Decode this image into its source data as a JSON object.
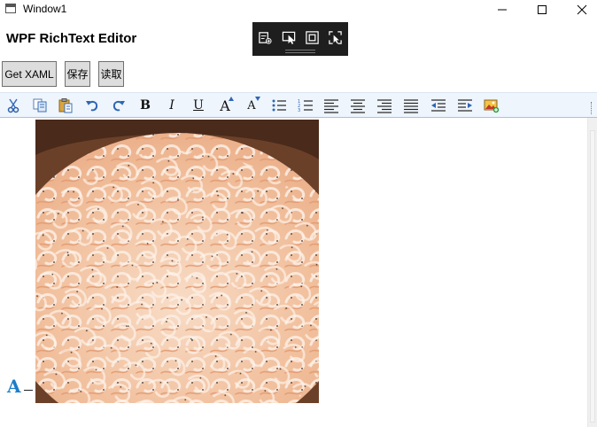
{
  "window": {
    "title": "Window1"
  },
  "app": {
    "heading": "WPF RichText Editor"
  },
  "buttons": {
    "get_xaml": "Get XAML",
    "save": "保存",
    "read": "读取"
  },
  "toolbar_icons": [
    "cut-icon",
    "copy-icon",
    "paste-icon",
    "undo-icon",
    "redo-icon",
    "bold-icon",
    "italic-icon",
    "underline-icon",
    "grow-font-icon",
    "shrink-font-icon",
    "bullet-list-icon",
    "numbered-list-icon",
    "align-left-icon",
    "align-center-icon",
    "align-right-icon",
    "justify-icon",
    "decrease-indent-icon",
    "increase-indent-icon",
    "insert-image-icon"
  ],
  "toolbar_glyphs": {
    "bold": "B",
    "italic": "I",
    "underline": "U",
    "grow": "A",
    "shrink": "A"
  },
  "editor": {
    "inline_glyph": "A"
  },
  "colors": {
    "accent": "#1a7ec8",
    "toolbar_bg": "#eef5fd",
    "debug_bar": "#1e1e1e"
  }
}
